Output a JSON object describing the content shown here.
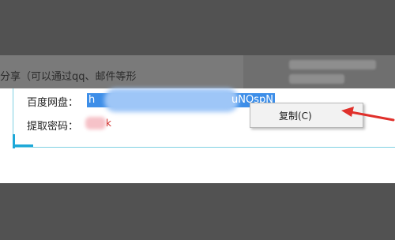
{
  "background": {
    "share_text": "分享（可以通过qq、邮件等形"
  },
  "share_panel": {
    "baidu_pan_label": "百度网盘：",
    "link_visible_start": "h",
    "link_visible_end": "uNOspN",
    "extraction_code_label": "提取密码：",
    "extraction_code_visible": "k"
  },
  "context_menu": {
    "copy_label": "复制(C)"
  },
  "annotation": {
    "arrow_color": "#e0302b"
  },
  "colors": {
    "overlay": "#525252",
    "selection": "#3d8ee8",
    "frame_accent": "#1ea8d8"
  }
}
